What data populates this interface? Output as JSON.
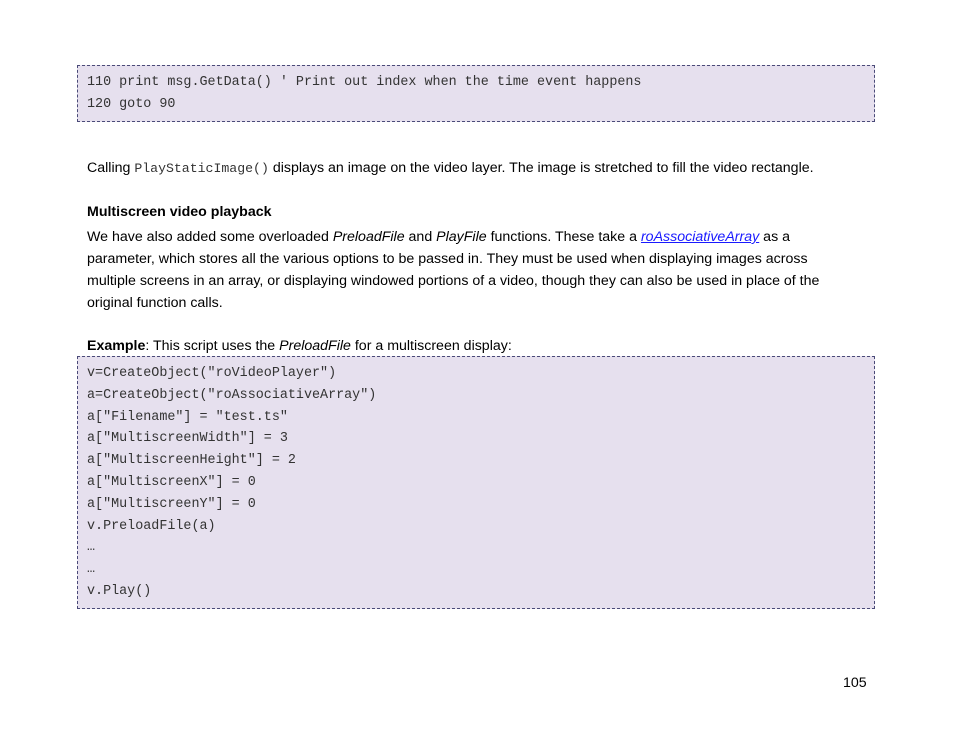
{
  "code_block_1": {
    "lines": [
      "110 print msg.GetData() ' Print out index when the time event happens",
      "120 goto 90"
    ]
  },
  "paragraph_1": {
    "prefix": "Calling ",
    "code": "PlayStaticImage()",
    "suffix": " displays an image on the video layer. The image is stretched to fill the video rectangle."
  },
  "section": {
    "heading": "Multiscreen video playback",
    "body_1": "We have also added some overloaded ",
    "italic_1": "PreloadFile",
    "body_2": " and ",
    "italic_2": "PlayFile",
    "body_3": " functions. These take a ",
    "link": "roAssociativeArray",
    "body_4": " as a parameter, which stores all the various options to be passed in. They must be used when displaying images across multiple screens in an array, or displaying windowed portions of a video, though they can also be used in place of the original function calls."
  },
  "example": {
    "label": "Example",
    "text_1": ": This script uses the ",
    "italic": "PreloadFile",
    "text_2": " for a multiscreen display:"
  },
  "code_block_2": {
    "lines": [
      "v=CreateObject(\"roVideoPlayer\")",
      "a=CreateObject(\"roAssociativeArray\")",
      "a[\"Filename\"] = \"test.ts\"",
      "a[\"MultiscreenWidth\"] = 3",
      "a[\"MultiscreenHeight\"] = 2",
      "a[\"MultiscreenX\"] = 0",
      "a[\"MultiscreenY\"] = 0",
      "v.PreloadFile(a)",
      "…",
      "…",
      "v.Play()"
    ]
  },
  "page_number": "105",
  "colors": {
    "code_background": "#e6e0ee",
    "code_border": "#4a4a78",
    "link": "#1a1aff"
  }
}
